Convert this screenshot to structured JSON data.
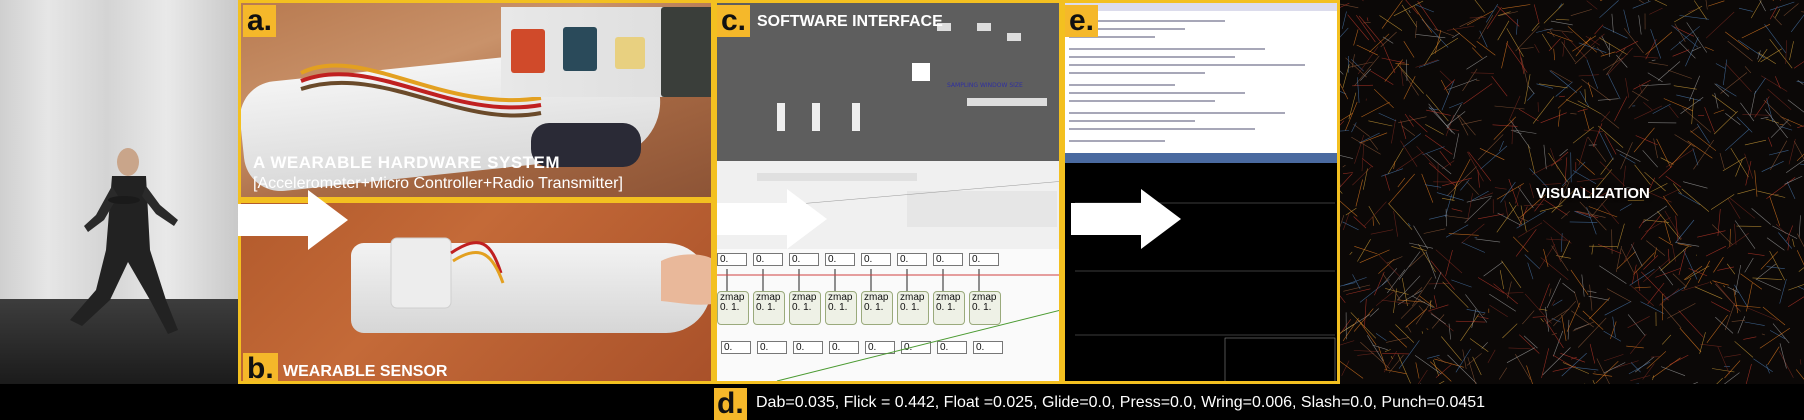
{
  "panels": {
    "a": {
      "badge": "a.",
      "caption_line1": "A WEARABLE HARDWARE SYSTEM",
      "caption_line2": "[Accelerometer+Micro Controller+Radio Transmitter]"
    },
    "b": {
      "badge": "b.",
      "caption": "WEARABLE SENSOR"
    },
    "c": {
      "badge": "c.",
      "title": "SOFTWARE INTERFACE",
      "zmap_label": "zmap",
      "zmap_values": "0. 1.",
      "number_box": "0."
    },
    "d": {
      "badge": "d.",
      "values": "Dab=0.035, Flick = 0.442, Float =0.025, Glide=0.0, Press=0.0, Wring=0.006, Slash=0.0, Punch=0.0451"
    },
    "e": {
      "badge": "e."
    },
    "visualization": {
      "label": "VISUALIZATION"
    }
  },
  "colors": {
    "accent": "#f3c020",
    "badge_bg": "#f5b82a",
    "background": "#000000"
  }
}
